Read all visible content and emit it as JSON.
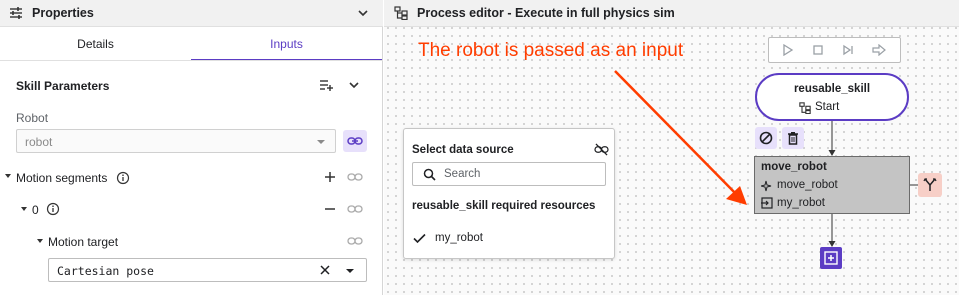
{
  "properties": {
    "title": "Properties",
    "tabs": [
      {
        "label": "Details",
        "active": false
      },
      {
        "label": "Inputs",
        "active": true
      }
    ],
    "skill_parameters": "Skill Parameters",
    "robot_label": "Robot",
    "robot_value": "robot",
    "motion_segments": "Motion segments",
    "segment_index": "0",
    "motion_target": "Motion target",
    "pose_value": "Cartesian pose"
  },
  "editor": {
    "title": "Process editor - Execute in full physics sim",
    "annotation": "The robot is passed as an input",
    "start_node": {
      "name": "reusable_skill",
      "sub": "Start"
    },
    "move_node": {
      "name": "move_robot",
      "row1": "move_robot",
      "row2": "my_robot"
    }
  },
  "popup": {
    "title": "Select data source",
    "search_placeholder": "Search",
    "section": "reusable_skill required resources",
    "item": "my_robot"
  },
  "colors": {
    "accent": "#5b3cc4",
    "accent_light": "#e7e0fb",
    "annotation": "#ff3d00",
    "branch": "#f7cfc7",
    "node_fill": "#c4c4c4"
  }
}
